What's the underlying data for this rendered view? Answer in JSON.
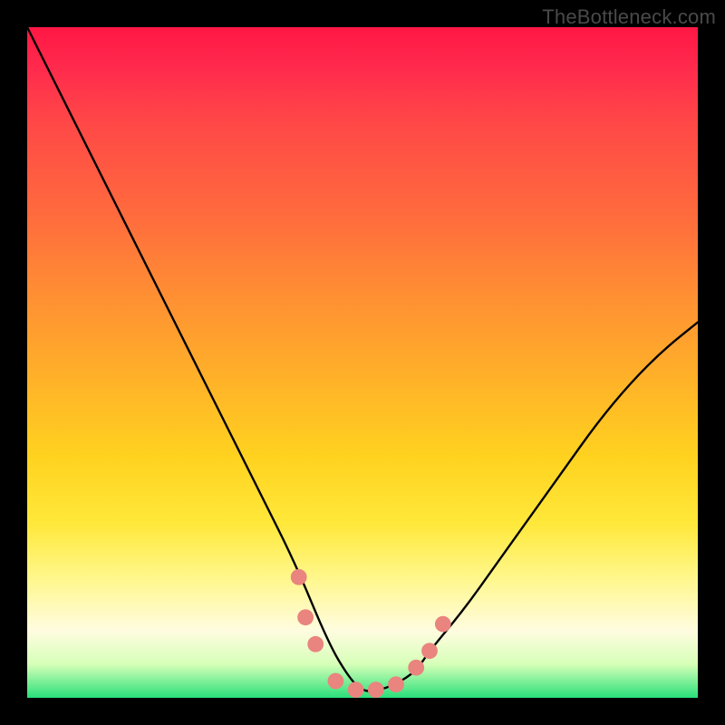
{
  "watermark": "TheBottleneck.com",
  "chart_data": {
    "type": "line",
    "title": "",
    "xlabel": "",
    "ylabel": "",
    "xlim": [
      0,
      100
    ],
    "ylim": [
      0,
      100
    ],
    "background_gradient": [
      "#ff1744",
      "#ff8f33",
      "#ffd21f",
      "#fffce0",
      "#29e07a"
    ],
    "series": [
      {
        "name": "bottleneck-curve",
        "x": [
          0,
          5,
          10,
          15,
          20,
          25,
          30,
          35,
          40,
          45,
          48,
          50,
          52,
          55,
          58,
          60,
          65,
          70,
          75,
          80,
          85,
          90,
          95,
          100
        ],
        "values": [
          100,
          90,
          80,
          70,
          60,
          50,
          40,
          30,
          20,
          8,
          3,
          1,
          1,
          2,
          4,
          7,
          13,
          20,
          27,
          34,
          41,
          47,
          52,
          56
        ]
      }
    ],
    "markers": [
      {
        "name": "left-dot-upper",
        "x": 40.5,
        "y": 18
      },
      {
        "name": "left-dot-lower",
        "x": 41.5,
        "y": 12
      },
      {
        "name": "left-dot-lower2",
        "x": 43.0,
        "y": 8
      },
      {
        "name": "valley-dot-1",
        "x": 46,
        "y": 2.5
      },
      {
        "name": "valley-dot-2",
        "x": 49,
        "y": 1.2
      },
      {
        "name": "valley-dot-3",
        "x": 52,
        "y": 1.2
      },
      {
        "name": "valley-dot-4",
        "x": 55,
        "y": 2.0
      },
      {
        "name": "right-dot-lower",
        "x": 58,
        "y": 4.5
      },
      {
        "name": "right-dot-mid",
        "x": 60,
        "y": 7
      },
      {
        "name": "right-dot-upper",
        "x": 62,
        "y": 11
      }
    ],
    "marker_style": {
      "color": "#e9847e",
      "radius_pct": 1.2
    }
  }
}
